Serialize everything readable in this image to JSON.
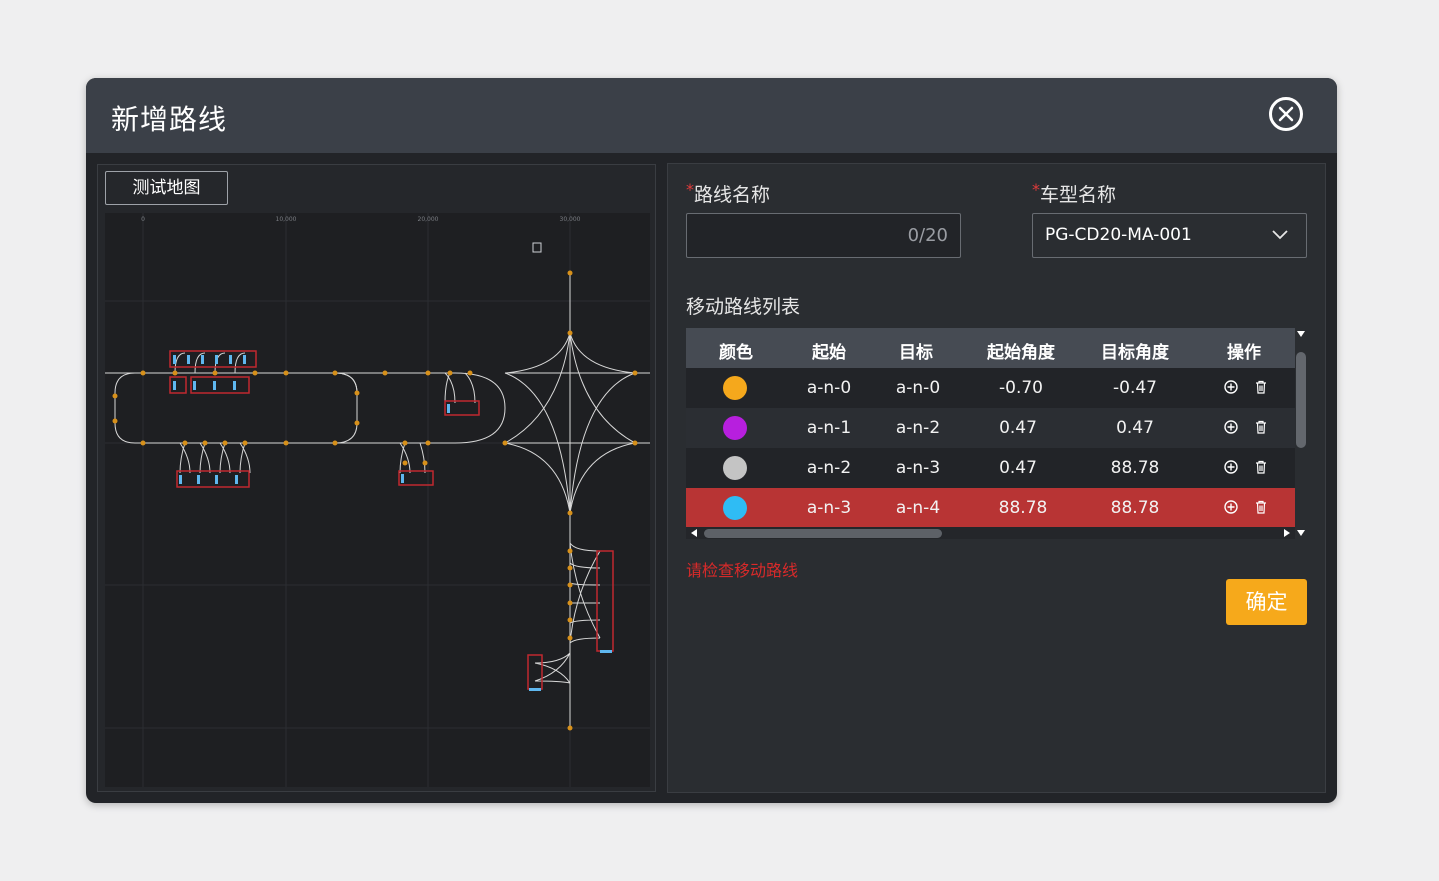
{
  "dialog": {
    "title": "新增路线"
  },
  "map": {
    "tag_label": "测试地图",
    "axis_ticks": [
      "0",
      "10,000",
      "20,000",
      "30,000"
    ]
  },
  "form": {
    "route_name_label": "路线名称",
    "route_name_value": "",
    "route_name_count": "0/20",
    "vehicle_label": "车型名称",
    "vehicle_value": "PG-CD20-MA-001",
    "required_mark": "*"
  },
  "route_list": {
    "title": "移动路线列表",
    "columns": [
      "颜色",
      "起始",
      "目标",
      "起始角度",
      "目标角度",
      "操作"
    ],
    "rows": [
      {
        "color": "#f5a81c",
        "start": "a-n-0",
        "target": "a-n-0",
        "start_angle": "-0.70",
        "target_angle": "-0.47"
      },
      {
        "color": "#b71fde",
        "start": "a-n-1",
        "target": "a-n-2",
        "start_angle": "0.47",
        "target_angle": "0.47"
      },
      {
        "color": "#c4c4c4",
        "start": "a-n-2",
        "target": "a-n-3",
        "start_angle": "0.47",
        "target_angle": "88.78"
      },
      {
        "color": "#2fbcf4",
        "start": "a-n-3",
        "target": "a-n-4",
        "start_angle": "88.78",
        "target_angle": "88.78"
      }
    ],
    "row_colors": [
      "#222428",
      "#2b2e33",
      "#222428",
      "#b83434"
    ]
  },
  "error_message": "请检查移动路线",
  "confirm_label": "确定",
  "icons": {
    "close": "close-circle-icon",
    "dropdown": "chevron-down-icon",
    "add": "plus-circle-icon",
    "delete": "trash-icon"
  }
}
